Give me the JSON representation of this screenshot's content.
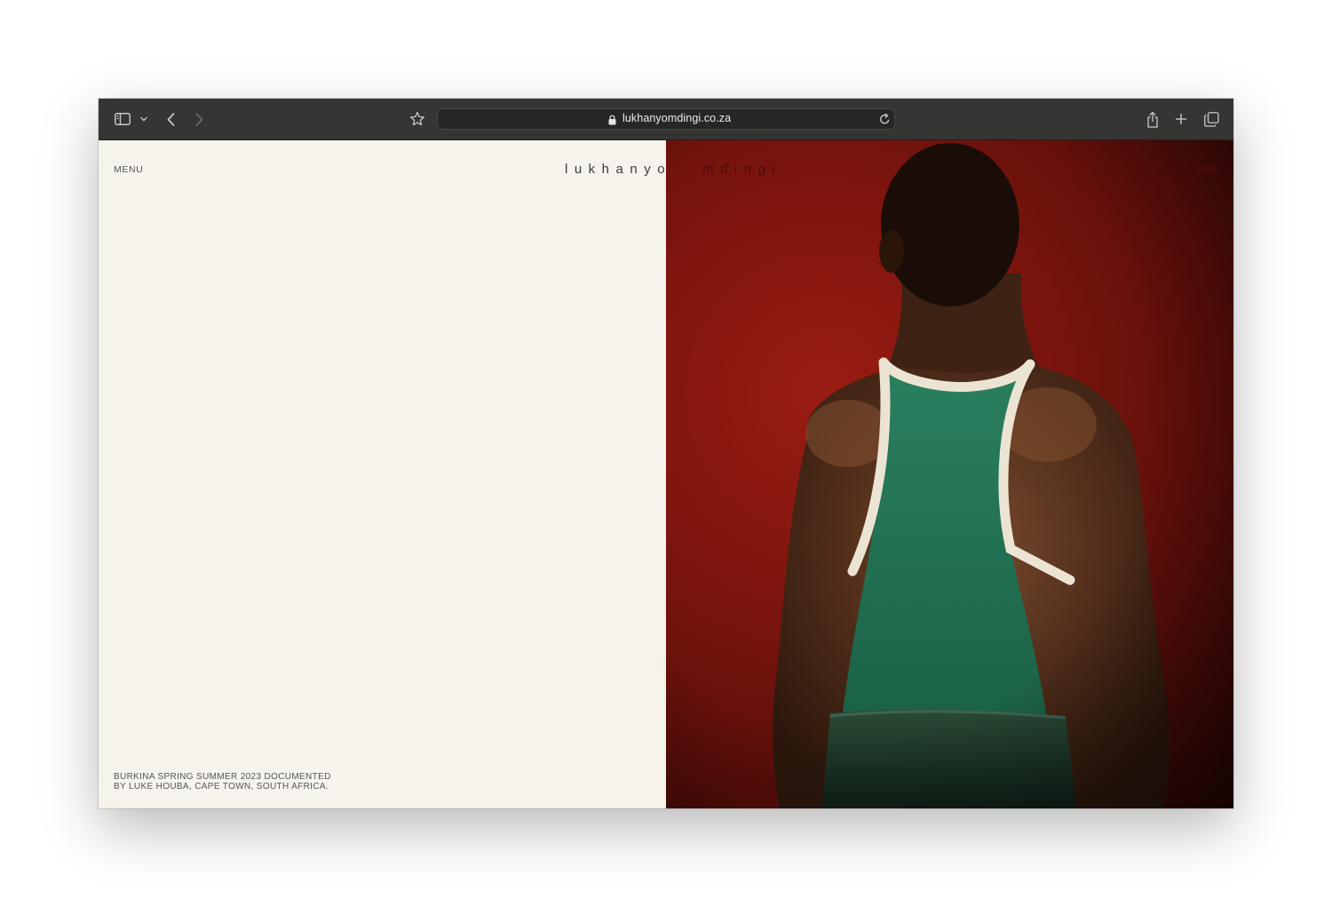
{
  "browser": {
    "url": "lukhanyomdingi.co.za",
    "icons": {
      "sidebar": "sidebar-icon",
      "sidebar_menu": "chevron-down-icon",
      "back": "chevron-left-icon",
      "forward": "chevron-right-icon",
      "bookmark": "star-icon",
      "lock": "lock-icon",
      "reload": "reload-icon",
      "share": "share-icon",
      "new_tab": "plus-icon",
      "tabs": "tab-overview-icon"
    }
  },
  "site": {
    "menu_label": "MENU",
    "logo_part1": "lukhanyo",
    "logo_part2": ". mdingi",
    "bag_label": "BAG",
    "caption_line1": "BURKINA SPRING SUMMER 2023 DOCUMENTED",
    "caption_line2": "BY LUKE HOUBA, CAPE TOWN, SOUTH AFRICA."
  },
  "colors": {
    "toolbar_bg": "#353533",
    "page_bg": "#f5f3ec",
    "backdrop_red": "#8a1810",
    "tank_green": "#1f6b4b"
  }
}
